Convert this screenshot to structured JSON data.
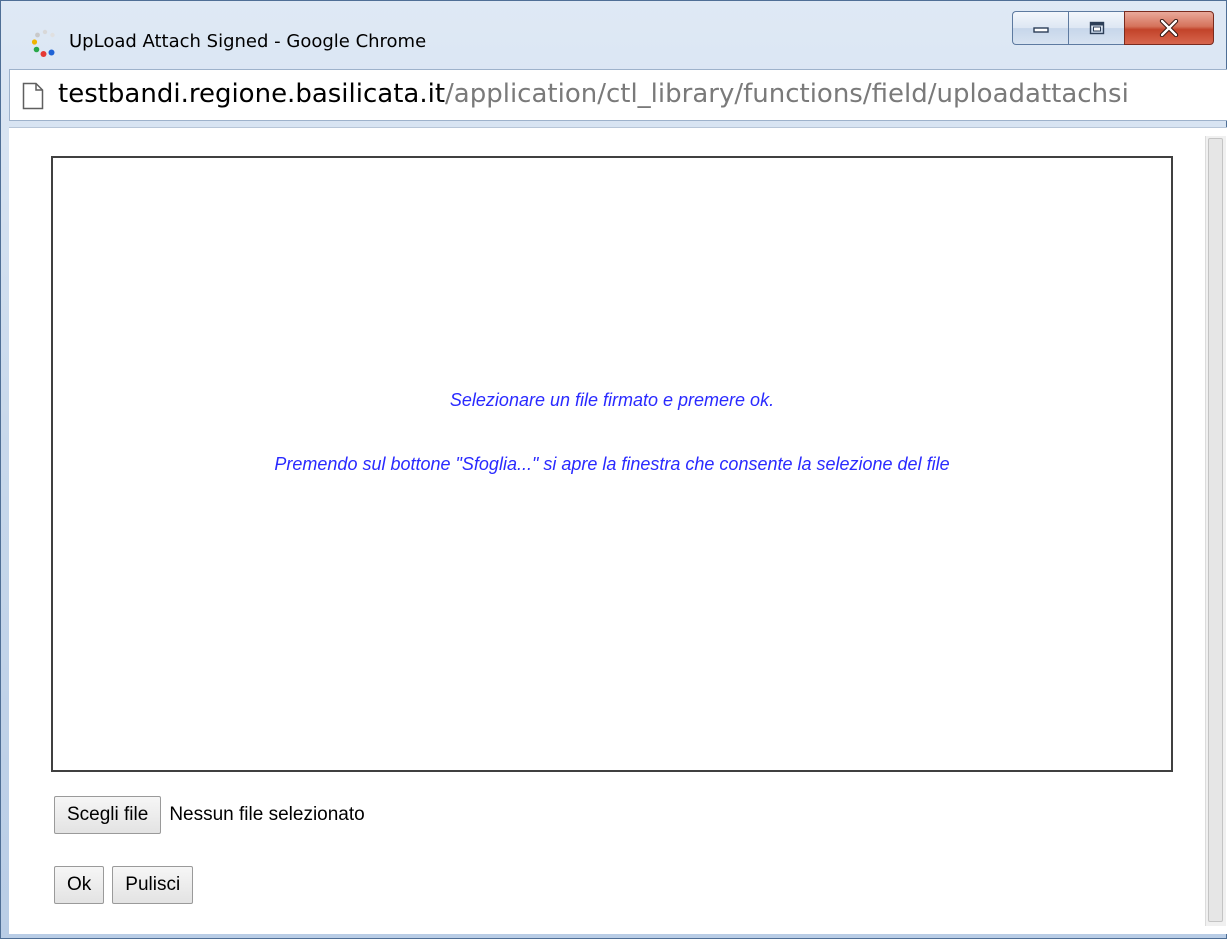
{
  "window": {
    "title": "UpLoad Attach Signed - Google Chrome"
  },
  "address": {
    "host": "testbandi.regione.basilicata.it",
    "path": "/application/ctl_library/functions/field/uploadattachsi"
  },
  "content": {
    "message_line1": "Selezionare un file firmato e premere ok.",
    "message_line2": "Premendo sul bottone \"Sfoglia...\" si apre la finestra che consente la selezione del file",
    "choose_file_label": "Scegli file",
    "no_file_text": "Nessun file selezionato",
    "ok_label": "Ok",
    "clear_label": "Pulisci"
  },
  "colors": {
    "message_text": "#2a2aff",
    "close_button": "#c2432a"
  },
  "icons": {
    "app": "chrome-loading-icon",
    "page": "page-icon",
    "minimize": "minimize-icon",
    "maximize": "maximize-icon",
    "close": "close-icon"
  }
}
